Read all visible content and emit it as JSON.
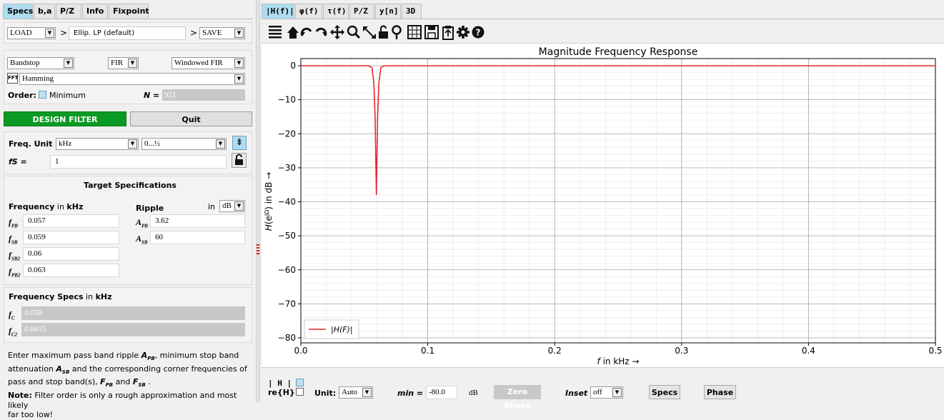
{
  "left_tabs": [
    "Specs",
    "b,a",
    "P/Z",
    "Info",
    "Fixpoint"
  ],
  "right_tabs": [
    "|H(f)|",
    "φ(f)",
    "τ(f)",
    "P/Z",
    "y[n]",
    "3D"
  ],
  "load_row": {
    "load": "LOAD",
    "gt1": ">",
    "preset": "Ellip. LP (default)",
    "gt2": ">",
    "save": "SAVE"
  },
  "filter": {
    "response_type": "Bandstop",
    "filter_class": "FIR",
    "design_method": "Windowed FIR",
    "fft_label": "FFT",
    "window": "Hamming",
    "order_label": "Order:",
    "minimum_label": "Minimum",
    "n_label": "N =",
    "n_value": "921"
  },
  "buttons": {
    "design": "DESIGN FILTER",
    "quit": "Quit"
  },
  "freq_unit": {
    "label": "Freq. Unit",
    "unit": "kHz",
    "range": "0...½",
    "fs_label": "fS =",
    "fs_value": "1"
  },
  "target": {
    "title": "Target Specifications",
    "freq_label": "Frequency",
    "freq_in": "in",
    "freq_unit": "kHz",
    "ripple_label": "Ripple",
    "ripple_in": "in",
    "ripple_unit": "dB",
    "freqs": [
      {
        "name": "fPB",
        "sub": "PB",
        "value": "0.057"
      },
      {
        "name": "fSB",
        "sub": "SB",
        "value": "0.059"
      },
      {
        "name": "fSB2",
        "sub": "SB2",
        "value": "0.06"
      },
      {
        "name": "fPB2",
        "sub": "PB2",
        "value": "0.063"
      }
    ],
    "ripples": [
      {
        "name": "APB",
        "sub": "PB",
        "value": "3.62"
      },
      {
        "name": "ASB",
        "sub": "SB",
        "value": "60"
      }
    ]
  },
  "freq_specs": {
    "title": "Frequency Specs",
    "in": "in",
    "unit": "kHz",
    "fc": "0.058",
    "fc2": "0.0615"
  },
  "help": {
    "line1": "Enter maximum pass band ripple",
    "line1b": ", minimum stop band",
    "line2a": "attenuation",
    "line2b": "and the corresponding corner frequencies of",
    "line3": "pass and stop band(s),",
    "line3b": "and",
    "note_label": "Note:",
    "note": "Filter order is only a rough approximation and most likely",
    "note2": "far too low!"
  },
  "plot": {
    "title": "Magnitude Frequency Response",
    "ylabel": "H(e^jΩ) in dB →",
    "xlabel": "f in kHz →",
    "legend": "|H(F)|",
    "line_color": "#e8262a"
  },
  "chart_data": {
    "type": "line",
    "title": "Magnitude Frequency Response",
    "xlabel": "f in kHz →",
    "ylabel": "H(e^jΩ) in dB →",
    "xlim": [
      0,
      0.5
    ],
    "ylim": [
      -80,
      0
    ],
    "x_ticks": [
      "0.0",
      "0.1",
      "0.2",
      "0.3",
      "0.4",
      "0.5"
    ],
    "y_ticks": [
      "0",
      "−10",
      "−20",
      "−30",
      "−40",
      "−50",
      "−60",
      "−70",
      "−80"
    ],
    "grid": true,
    "legend_position": "lower-left",
    "series": [
      {
        "name": "|H(F)|",
        "x": [
          0.0,
          0.053,
          0.056,
          0.0575,
          0.0585,
          0.0595,
          0.0605,
          0.0615,
          0.063,
          0.066,
          0.5
        ],
        "y": [
          0.0,
          0.0,
          -0.5,
          -5,
          -15,
          -38,
          -15,
          -5,
          -0.5,
          0.0,
          0.0
        ]
      }
    ]
  },
  "bottom": {
    "h_label": "| H |",
    "re_label": "re{H}",
    "unit_label": "Unit:",
    "unit_value": "Auto",
    "min_label": "min =",
    "min_value": "-80.0",
    "db_label": "dB",
    "zero_phase": "Zero Phase",
    "inset_label": "Inset",
    "inset_value": "off",
    "specs_btn": "Specs",
    "phase_btn": "Phase"
  },
  "toolbar_icons": [
    "menu-icon",
    "home-icon",
    "undo-icon",
    "redo-icon",
    "pan-icon",
    "zoom-icon",
    "fit-icon",
    "lock-icon",
    "locate-icon",
    "grid-icon",
    "save-icon",
    "clipboard-icon",
    "settings-icon",
    "help-icon"
  ]
}
